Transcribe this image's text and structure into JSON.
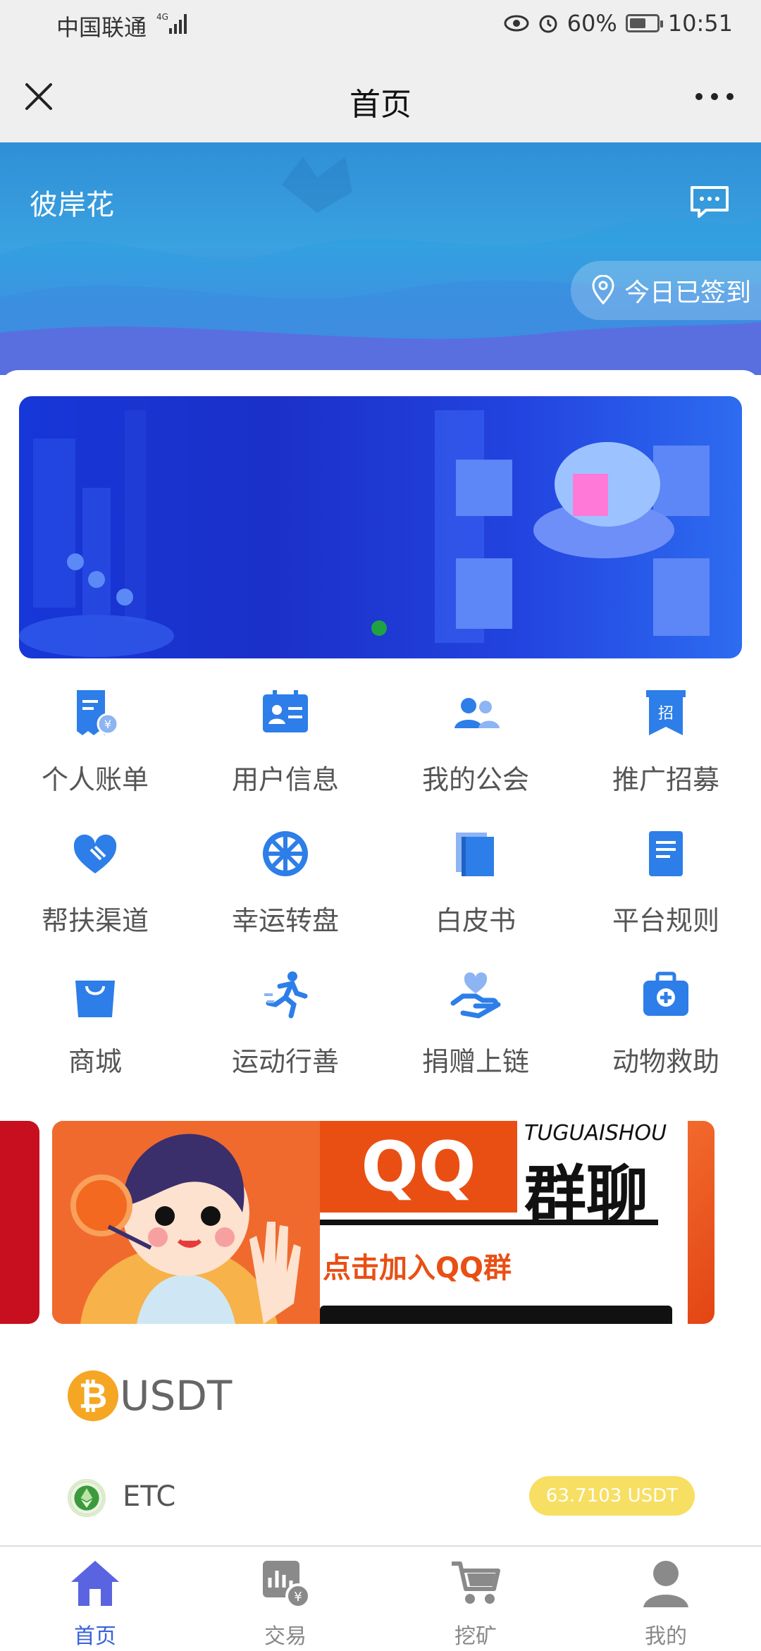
{
  "status_bar": {
    "carrier": "中国联通",
    "network": "4G",
    "battery": "60%",
    "time": "10:51"
  },
  "nav": {
    "title": "首页"
  },
  "hero": {
    "username": "彼岸花",
    "checkin_label": "今日已签到"
  },
  "grid": [
    {
      "label": "个人账单",
      "icon": "bill-icon"
    },
    {
      "label": "用户信息",
      "icon": "id-card-icon"
    },
    {
      "label": "我的公会",
      "icon": "group-icon"
    },
    {
      "label": "推广招募",
      "icon": "recruit-icon"
    },
    {
      "label": "帮扶渠道",
      "icon": "heart-hand-icon"
    },
    {
      "label": "幸运转盘",
      "icon": "wheel-icon"
    },
    {
      "label": "白皮书",
      "icon": "book-icon"
    },
    {
      "label": "平台规则",
      "icon": "rules-icon"
    },
    {
      "label": "商城",
      "icon": "shopping-bag-icon"
    },
    {
      "label": "运动行善",
      "icon": "running-icon"
    },
    {
      "label": "捐赠上链",
      "icon": "donate-icon"
    },
    {
      "label": "动物救助",
      "icon": "medical-kit-icon"
    }
  ],
  "promo": {
    "qq": "QQ",
    "brand": "TUGUAISHOU",
    "title": "群聊",
    "cta": "点击加入QQ群"
  },
  "wallet": {
    "title": "USDT",
    "coin_symbol": "₿",
    "rows": [
      {
        "name": "ETC",
        "value": "63.7103 USDT"
      }
    ]
  },
  "tabs": [
    {
      "label": "首页",
      "icon": "home-icon"
    },
    {
      "label": "交易",
      "icon": "chart-yen-icon"
    },
    {
      "label": "挖矿",
      "icon": "cart-icon"
    },
    {
      "label": "我的",
      "icon": "user-icon"
    }
  ],
  "colors": {
    "accent": "#3a62d8",
    "icon_blue": "#2d7ee8",
    "badge": "#f7df63"
  }
}
